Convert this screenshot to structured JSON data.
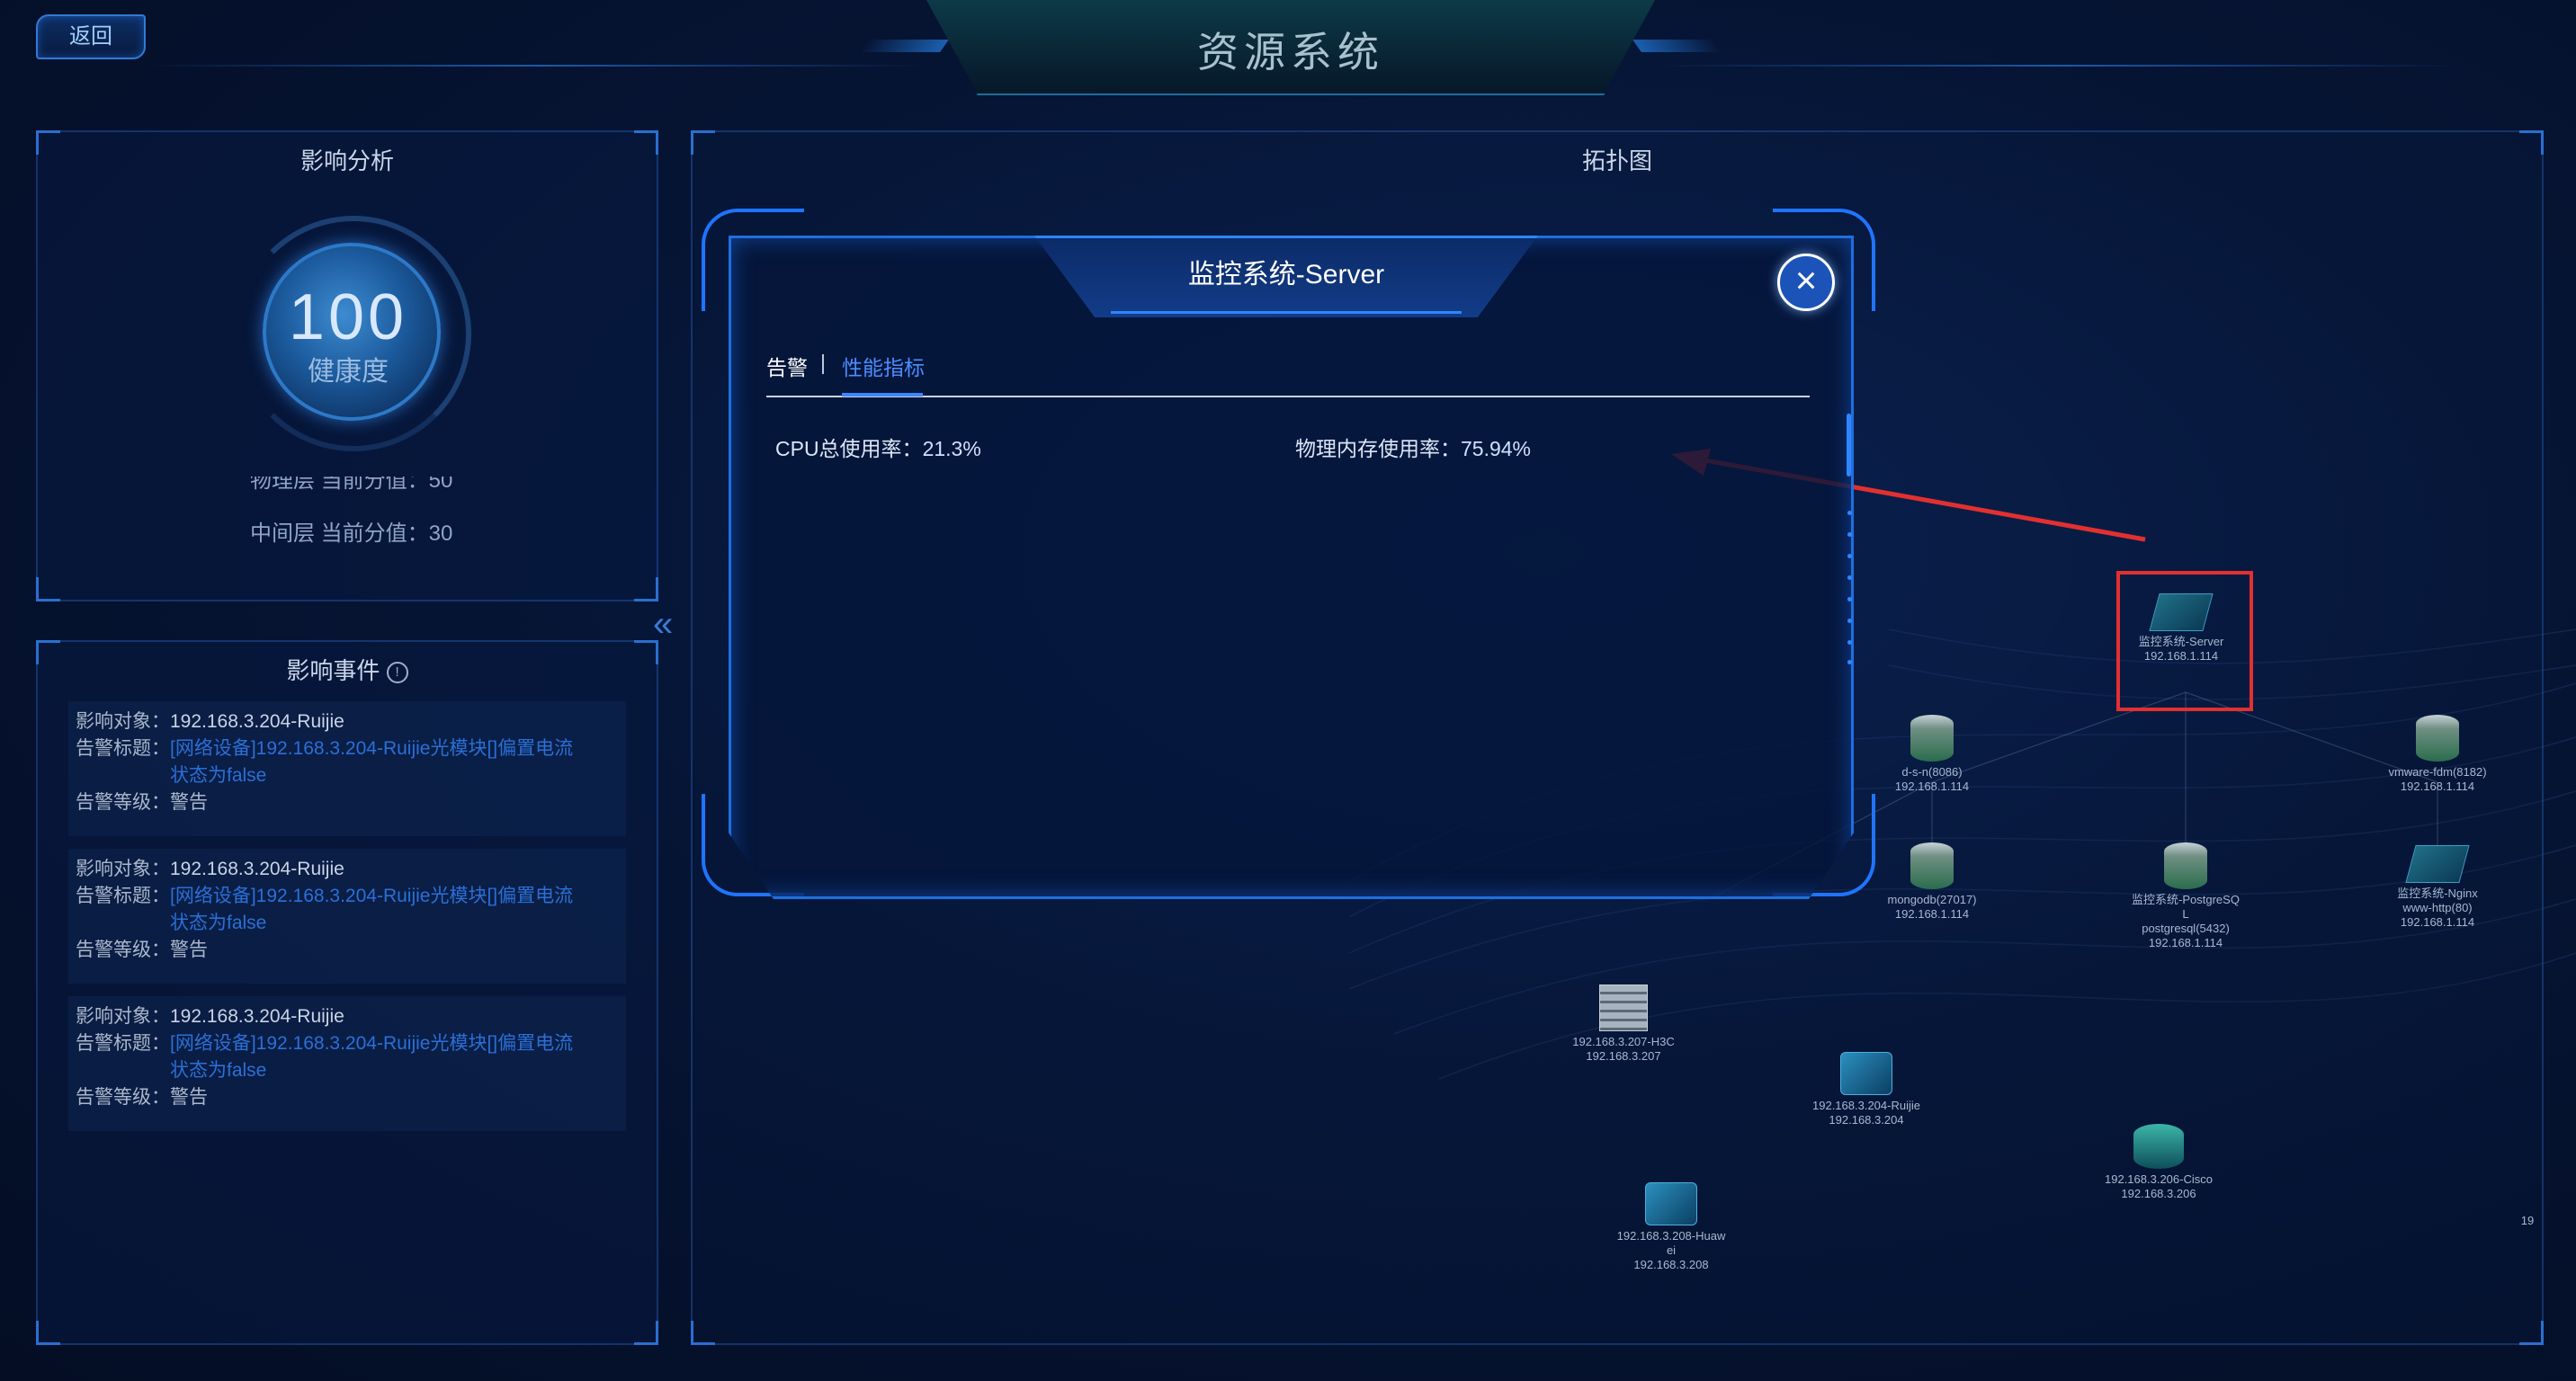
{
  "header": {
    "back_label": "返回",
    "title": "资源系统"
  },
  "impact_analysis": {
    "title": "影响分析",
    "health_value": "100",
    "health_label": "健康度",
    "score_lines": [
      "物理层  当前分值：50",
      "中间层  当前分值：30"
    ]
  },
  "impact_events": {
    "title": "影响事件",
    "info_icon": "info-circle-icon",
    "events": [
      {
        "target_key": "影响对象：",
        "target": "192.168.3.204-Ruijie",
        "alert_key": "告警标题：",
        "alert_line1": "[网络设备]192.168.3.204-Ruijie光模块[]偏置电流",
        "alert_line2": "状态为false",
        "level_key": "告警等级：",
        "level": "警告"
      },
      {
        "target_key": "影响对象：",
        "target": "192.168.3.204-Ruijie",
        "alert_key": "告警标题：",
        "alert_line1": "[网络设备]192.168.3.204-Ruijie光模块[]偏置电流",
        "alert_line2": "状态为false",
        "level_key": "告警等级：",
        "level": "警告"
      },
      {
        "target_key": "影响对象：",
        "target": "192.168.3.204-Ruijie",
        "alert_key": "告警标题：",
        "alert_line1": "[网络设备]192.168.3.204-Ruijie光模块[]偏置电流",
        "alert_line2": "状态为false",
        "level_key": "告警等级：",
        "level": "警告"
      }
    ]
  },
  "topology": {
    "title": "拓扑图",
    "nodes": [
      {
        "id": "server",
        "type": "server",
        "lines": [
          "监控系统-Server",
          "192.168.1.114"
        ]
      },
      {
        "id": "dsn",
        "type": "db",
        "lines": [
          "d-s-n(8086)",
          "192.168.1.114"
        ]
      },
      {
        "id": "vmware",
        "type": "db",
        "lines": [
          "vmware-fdm(8182)",
          "192.168.1.114"
        ]
      },
      {
        "id": "mongodb",
        "type": "db",
        "lines": [
          "mongodb(27017)",
          "192.168.1.114"
        ]
      },
      {
        "id": "postgres",
        "type": "db",
        "lines": [
          "监控系统-PostgreSQ",
          "L",
          "postgresql(5432)",
          "192.168.1.114"
        ]
      },
      {
        "id": "nginx",
        "type": "server",
        "lines": [
          "监控系统-Nginx",
          "www-http(80)",
          "192.168.1.114"
        ]
      },
      {
        "id": "h3c",
        "type": "firewall",
        "lines": [
          "192.168.3.207-H3C",
          "192.168.3.207"
        ]
      },
      {
        "id": "ruijie",
        "type": "switch",
        "lines": [
          "192.168.3.204-Ruijie",
          "192.168.3.204"
        ]
      },
      {
        "id": "cisco",
        "type": "router",
        "lines": [
          "192.168.3.206-Cisco",
          "192.168.3.206"
        ]
      },
      {
        "id": "huawei",
        "type": "switch",
        "lines": [
          "192.168.3.208-Huaw",
          "ei",
          "192.168.3.208"
        ]
      }
    ],
    "edge_label": "19"
  },
  "dialog": {
    "title": "监控系统-Server",
    "tabs": [
      "告警",
      "性能指标"
    ],
    "tab_separator": "|",
    "active_tab": "性能指标",
    "metrics": {
      "cpu_label": "CPU总使用率：",
      "cpu_value": "21.3%",
      "mem_label": "物理内存使用率：",
      "mem_value": "75.94%"
    }
  },
  "colors": {
    "accent": "#1e6fe0",
    "link": "#2b6fd6",
    "highlight": "#e23030"
  }
}
